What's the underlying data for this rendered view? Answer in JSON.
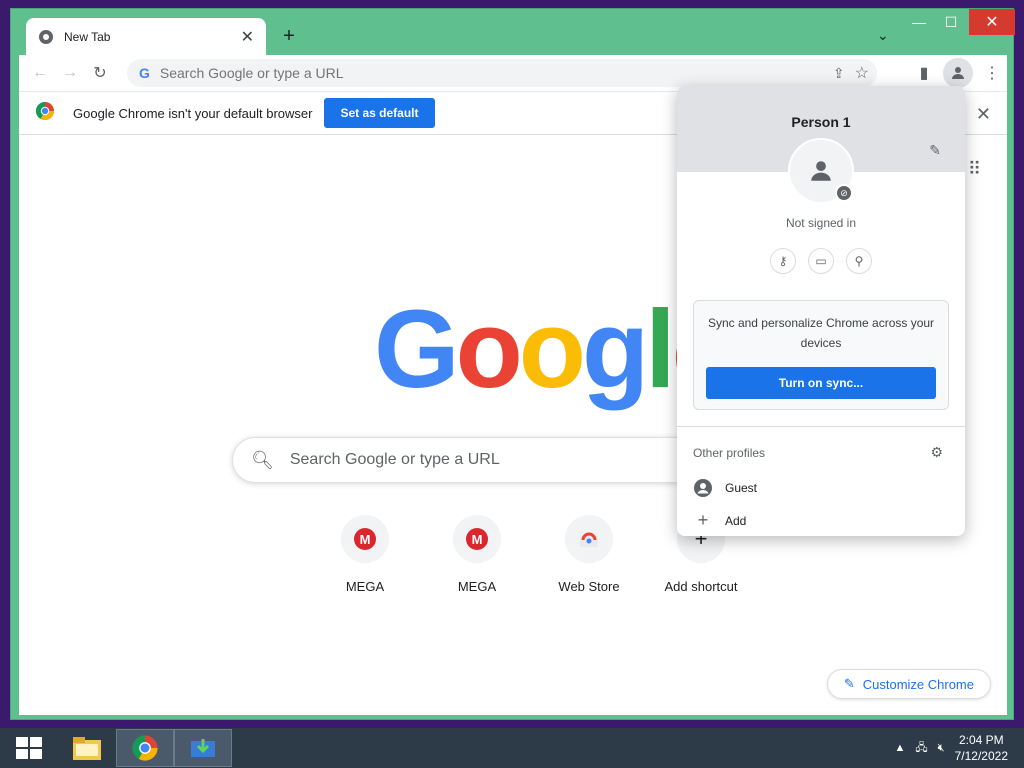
{
  "tab": {
    "title": "New Tab"
  },
  "omnibox": {
    "placeholder": "Search Google or type a URL"
  },
  "infobar": {
    "message": "Google Chrome isn't your default browser",
    "button": "Set as default"
  },
  "ntp": {
    "search_placeholder": "Search Google or type a URL",
    "shortcuts": [
      {
        "label": "MEGA",
        "icon": "mega-icon"
      },
      {
        "label": "MEGA",
        "icon": "mega-icon"
      },
      {
        "label": "Web Store",
        "icon": "webstore-icon"
      },
      {
        "label": "Add shortcut",
        "icon": "plus-icon"
      }
    ],
    "customize": "Customize Chrome"
  },
  "profile_popup": {
    "name": "Person 1",
    "status": "Not signed in",
    "sync_text": "Sync and personalize Chrome across your devices",
    "sync_button": "Turn on sync...",
    "other_profiles": "Other profiles",
    "guest": "Guest",
    "add": "Add"
  },
  "taskbar": {
    "time": "2:04 PM",
    "date": "7/12/2022"
  },
  "colors": {
    "accent": "#1a73e8",
    "frame": "#5fbf8e",
    "desktop": "#3b1a6e",
    "taskbar": "#2d3b49"
  }
}
